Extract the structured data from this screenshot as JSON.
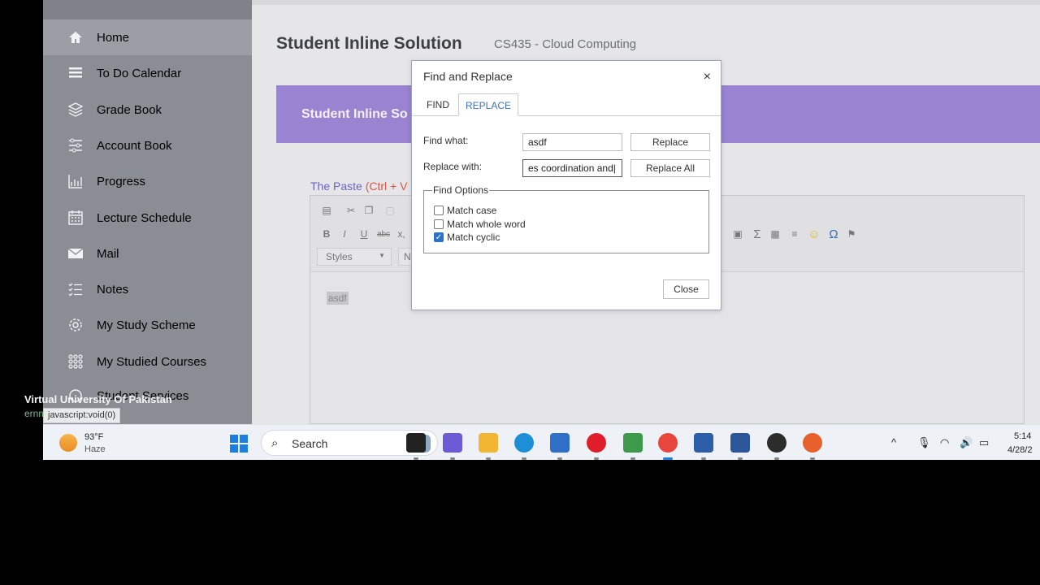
{
  "sidebar": {
    "items": [
      {
        "label": "Home",
        "icon": "home-icon",
        "active": true
      },
      {
        "label": "To Do Calendar",
        "icon": "list-icon"
      },
      {
        "label": "Grade Book",
        "icon": "layers-icon"
      },
      {
        "label": "Account Book",
        "icon": "sliders-icon"
      },
      {
        "label": "Progress",
        "icon": "chart-icon"
      },
      {
        "label": "Lecture Schedule",
        "icon": "calendar-icon"
      },
      {
        "label": "Mail",
        "icon": "mail-icon"
      },
      {
        "label": "Notes",
        "icon": "checklist-icon"
      },
      {
        "label": "My Study Scheme",
        "icon": "gear-icon"
      },
      {
        "label": "My Studied Courses",
        "icon": "grid-icon"
      },
      {
        "label": "Student Services",
        "icon": "services-icon"
      }
    ],
    "footer_title": "Virtual University Of Pakistan",
    "footer_subtitle": "ernment University"
  },
  "status_url": "javascript:void(0)",
  "main": {
    "title": "Student Inline Solution",
    "course": "CS435 - Cloud Computing",
    "banner_text": "Student Inline So",
    "editor_label": "The Paste",
    "editor_hint": "(Ctrl + V",
    "styles_select": "Styles",
    "format_select": "N",
    "editor_content": "asdf"
  },
  "dialog": {
    "title": "Find and Replace",
    "close_glyph": "×",
    "tabs": [
      {
        "label": "FIND",
        "active": false
      },
      {
        "label": "REPLACE",
        "active": true
      }
    ],
    "find_label": "Find what:",
    "find_value": "asdf",
    "replace_label": "Replace with:",
    "replace_value": "es coordination and|",
    "replace_button": "Replace",
    "replace_all_button": "Replace All",
    "options_legend": "Find Options",
    "options": [
      {
        "label": "Match case",
        "checked": false
      },
      {
        "label": "Match whole word",
        "checked": false
      },
      {
        "label": "Match cyclic",
        "checked": true
      }
    ],
    "close_button": "Close"
  },
  "taskbar": {
    "weather_temp": "93°F",
    "weather_desc": "Haze",
    "search_placeholder": "Search",
    "apps": [
      {
        "name": "task-view",
        "color": "#222222"
      },
      {
        "name": "teams",
        "color": "#6b5bd6"
      },
      {
        "name": "file-explorer",
        "color": "#f2b632"
      },
      {
        "name": "edge",
        "color": "#1c8fd6"
      },
      {
        "name": "store",
        "color": "#2f6fc8"
      },
      {
        "name": "opera",
        "color": "#e01e2b"
      },
      {
        "name": "app-6",
        "color": "#3d9a4a"
      },
      {
        "name": "chrome",
        "color": "#e8453c"
      },
      {
        "name": "virtualbox",
        "color": "#2b5da8"
      },
      {
        "name": "word",
        "color": "#2b579a"
      },
      {
        "name": "obs",
        "color": "#2c2c2c"
      },
      {
        "name": "media-player",
        "color": "#e8612c"
      }
    ],
    "time": "5:14",
    "date": "4/28/2"
  }
}
